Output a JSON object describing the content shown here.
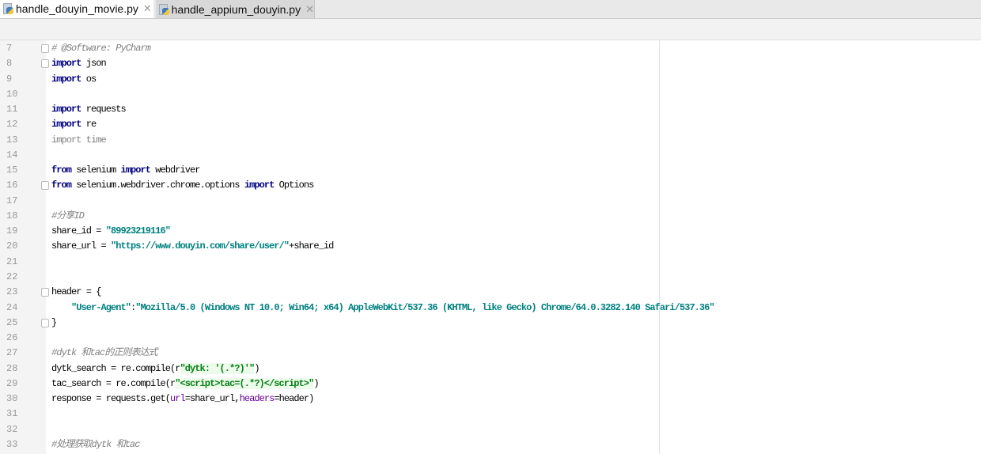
{
  "tabs": [
    {
      "label": "handle_douyin_movie.py",
      "active": true
    },
    {
      "label": "handle_appium_douyin.py",
      "active": false
    }
  ],
  "editor": {
    "lines": [
      {
        "n": "7",
        "fold": true,
        "tokens": [
          [
            "# @Software: PyCharm",
            "c"
          ]
        ]
      },
      {
        "n": "8",
        "fold": true,
        "tokens": [
          [
            "import",
            "k"
          ],
          [
            " json",
            ""
          ]
        ]
      },
      {
        "n": "9",
        "tokens": [
          [
            "import",
            "k"
          ],
          [
            " os",
            ""
          ]
        ]
      },
      {
        "n": "10",
        "tokens": []
      },
      {
        "n": "11",
        "tokens": [
          [
            "import",
            "k"
          ],
          [
            " requests",
            ""
          ]
        ]
      },
      {
        "n": "12",
        "tokens": [
          [
            "import",
            "k"
          ],
          [
            " re",
            ""
          ]
        ]
      },
      {
        "n": "13",
        "tokens": [
          [
            "import time",
            "u"
          ]
        ]
      },
      {
        "n": "14",
        "tokens": []
      },
      {
        "n": "15",
        "tokens": [
          [
            "from",
            "k"
          ],
          [
            " selenium ",
            ""
          ],
          [
            "import",
            "k"
          ],
          [
            " webdriver",
            ""
          ]
        ]
      },
      {
        "n": "16",
        "fold": true,
        "tokens": [
          [
            "from",
            "k"
          ],
          [
            " selenium.webdriver.chrome.options ",
            ""
          ],
          [
            "import",
            "k"
          ],
          [
            " Options",
            ""
          ]
        ]
      },
      {
        "n": "17",
        "tokens": []
      },
      {
        "n": "18",
        "tokens": [
          [
            "#分享ID",
            "c"
          ]
        ]
      },
      {
        "n": "19",
        "tokens": [
          [
            "share_id = ",
            ""
          ],
          [
            "\"89923219116\"",
            "s"
          ]
        ]
      },
      {
        "n": "20",
        "tokens": [
          [
            "share_url = ",
            ""
          ],
          [
            "\"https://www.douyin.com/share/user/\"",
            "s"
          ],
          [
            "+share_id",
            ""
          ]
        ]
      },
      {
        "n": "21",
        "tokens": []
      },
      {
        "n": "22",
        "tokens": []
      },
      {
        "n": "23",
        "fold": true,
        "tokens": [
          [
            "header = {",
            ""
          ]
        ]
      },
      {
        "n": "24",
        "tokens": [
          [
            "    ",
            ""
          ],
          [
            "\"User-Agent\"",
            "s"
          ],
          [
            ":",
            ""
          ],
          [
            "\"Mozilla/5.0 (Windows NT 10.0; Win64; x64) AppleWebKit/537.36 (KHTML, like Gecko) Chrome/64.0.3282.140 Safari/537.36\"",
            "s"
          ]
        ]
      },
      {
        "n": "25",
        "fold": true,
        "tokens": [
          [
            "}",
            ""
          ]
        ]
      },
      {
        "n": "26",
        "tokens": []
      },
      {
        "n": "27",
        "tokens": [
          [
            "#dytk 和tac的正则表达式",
            "c"
          ]
        ]
      },
      {
        "n": "28",
        "tokens": [
          [
            "dytk_search = re.compile(r",
            ""
          ],
          [
            "\"dytk: '(.*?)'\"",
            "r"
          ],
          [
            ")",
            ""
          ]
        ]
      },
      {
        "n": "29",
        "tokens": [
          [
            "tac_search = re.compile(r",
            ""
          ],
          [
            "\"<script>tac=(.*?)</script>\"",
            "r"
          ],
          [
            ")",
            ""
          ]
        ]
      },
      {
        "n": "30",
        "tokens": [
          [
            "response = requests.get(",
            ""
          ],
          [
            "url",
            "p"
          ],
          [
            "=share_url,",
            ""
          ],
          [
            "headers",
            "p"
          ],
          [
            "=header)",
            ""
          ]
        ]
      },
      {
        "n": "31",
        "tokens": []
      },
      {
        "n": "32",
        "tokens": []
      },
      {
        "n": "33",
        "tokens": [
          [
            "#处理获取dytk 和tac",
            "c"
          ]
        ]
      }
    ]
  }
}
